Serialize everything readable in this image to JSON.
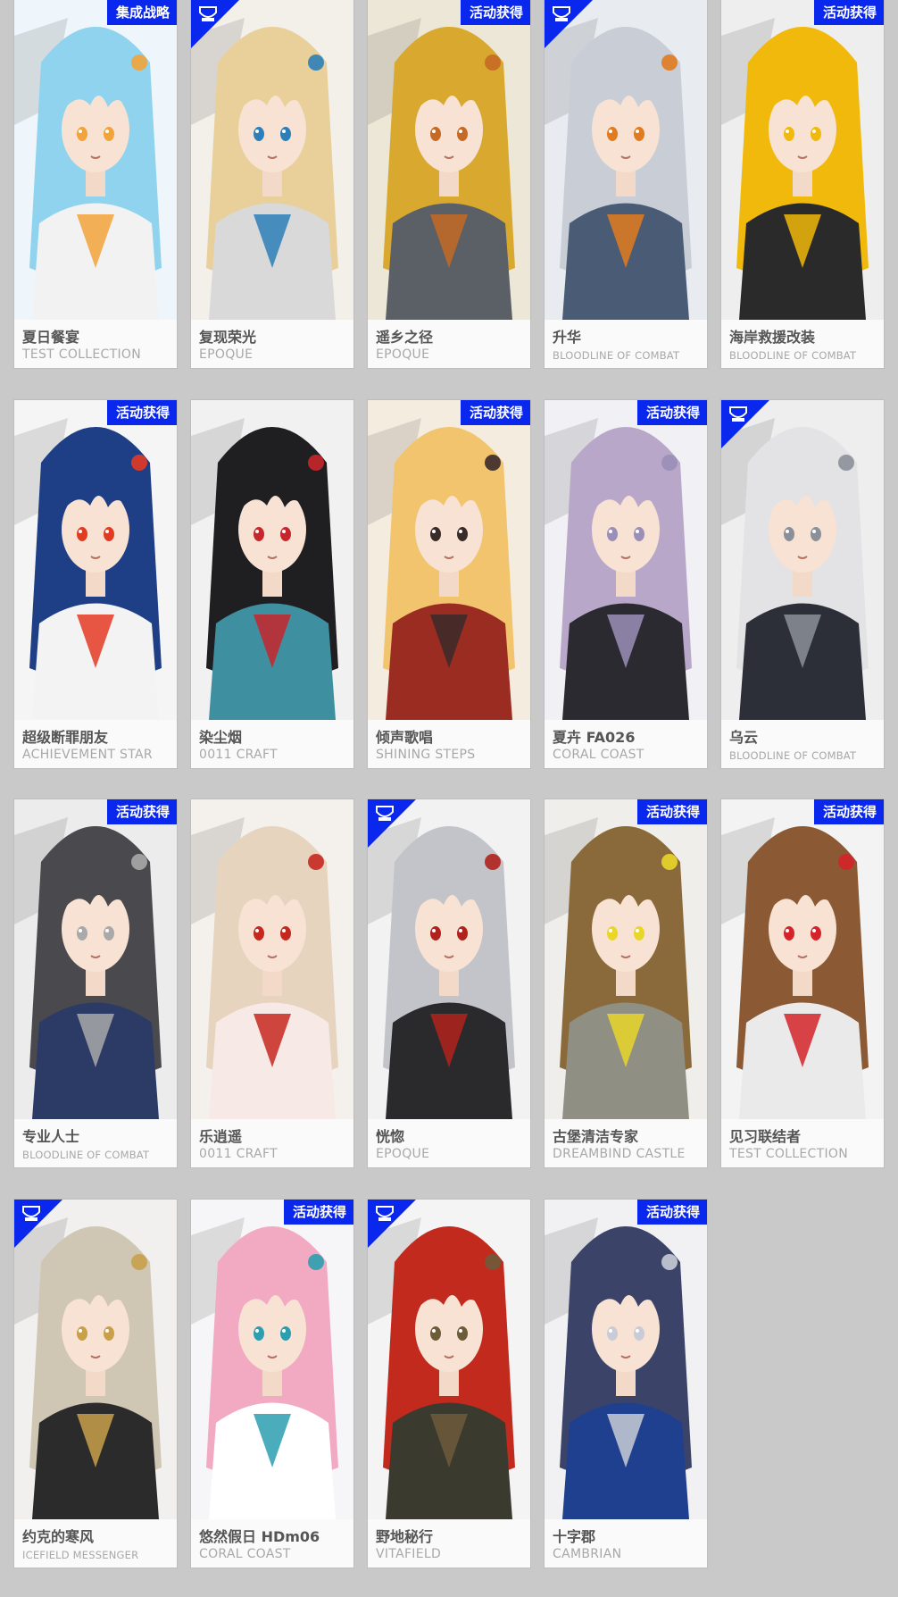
{
  "badge_text": "活动获得",
  "cards": [
    {
      "cn": "夏日餐宴",
      "en": "TEST COLLECTION",
      "badge": "集成战略",
      "hair": "#8fd3ee",
      "bg": "#eef6fb",
      "coat": "#f2f2f2",
      "accent": "#f2a33a"
    },
    {
      "cn": "复现荣光",
      "en": "EPOQUE",
      "badge": "corner",
      "hair": "#e9cf9a",
      "bg": "#f3f0ea",
      "coat": "#d9d9d9",
      "accent": "#2c7fb8"
    },
    {
      "cn": "遥乡之径",
      "en": "EPOQUE",
      "badge": "活动获得",
      "hair": "#d9a92f",
      "bg": "#ede7d7",
      "coat": "#5b5f66",
      "accent": "#c56a25"
    },
    {
      "cn": "升华",
      "en": "BLOODLINE OF COMBAT",
      "badge": "corner",
      "hair": "#c9ced6",
      "bg": "#e8ecf1",
      "coat": "#4a5b75",
      "accent": "#e07b1f"
    },
    {
      "cn": "海岸救援改装",
      "en": "BLOODLINE OF COMBAT",
      "badge": "活动获得",
      "hair": "#f0b90b",
      "bg": "#eeeeee",
      "coat": "#2a2a2a",
      "accent": "#f0b90b"
    },
    {
      "cn": "超级断罪朋友",
      "en": "ACHIEVEMENT STAR",
      "badge": "活动获得",
      "hair": "#1e3f86",
      "bg": "#f5f5f5",
      "coat": "#f3f3f3",
      "accent": "#e33a22"
    },
    {
      "cn": "染尘烟",
      "en": "0011 CRAFT",
      "badge": "",
      "hair": "#1f1f22",
      "bg": "#f1f1f1",
      "coat": "#3e8fa0",
      "accent": "#c7262b"
    },
    {
      "cn": "倾声歌唱",
      "en": "SHINING STEPS",
      "badge": "活动获得",
      "hair": "#f2c46e",
      "bg": "#f5ece0",
      "coat": "#9b2c22",
      "accent": "#3a2a2a"
    },
    {
      "cn": "夏卉 FA026",
      "en": "CORAL COAST",
      "badge": "活动获得",
      "hair": "#b8a7c9",
      "bg": "#f1f0f4",
      "coat": "#2a2a30",
      "accent": "#9a8fb8"
    },
    {
      "cn": "乌云",
      "en": "BLOODLINE OF COMBAT",
      "badge": "corner",
      "hair": "#e3e3e6",
      "bg": "#eeeeee",
      "coat": "#2d2f38",
      "accent": "#8b8f99"
    },
    {
      "cn": "专业人士",
      "en": "BLOODLINE OF COMBAT",
      "badge": "活动获得",
      "hair": "#4a4a4e",
      "bg": "#ececec",
      "coat": "#2c3a66",
      "accent": "#a9a9a9"
    },
    {
      "cn": "乐逍遥",
      "en": "0011 CRAFT",
      "badge": "",
      "hair": "#e6d4bf",
      "bg": "#f4f1ec",
      "coat": "#f7e9e6",
      "accent": "#c5281f"
    },
    {
      "cn": "恍惚",
      "en": "EPOQUE",
      "badge": "corner",
      "hair": "#c2c4c9",
      "bg": "#f2f2f2",
      "coat": "#2a2a2d",
      "accent": "#b0221c"
    },
    {
      "cn": "古堡清洁专家",
      "en": "DREAMBIND CASTLE",
      "badge": "活动获得",
      "hair": "#8a6a3a",
      "bg": "#efeeea",
      "coat": "#8f8f84",
      "accent": "#e8d629"
    },
    {
      "cn": "见习联结者",
      "en": "TEST COLLECTION",
      "badge": "活动获得",
      "hair": "#8b5a34",
      "bg": "#f3f3f3",
      "coat": "#eaeaea",
      "accent": "#d4242a"
    },
    {
      "cn": "约克的寒风",
      "en": "ICEFIELD MESSENGER",
      "badge": "corner",
      "hair": "#cfc6b4",
      "bg": "#f1f0ee",
      "coat": "#2b2b2b",
      "accent": "#c9a04a"
    },
    {
      "cn": "悠然假日 HDm06",
      "en": "CORAL COAST",
      "badge": "活动获得",
      "hair": "#f2a9c2",
      "bg": "#f6f6f8",
      "coat": "#ffffff",
      "accent": "#2b9fb0"
    },
    {
      "cn": "野地秘行",
      "en": "VITAFIELD",
      "badge": "corner",
      "hair": "#c32a1e",
      "bg": "#f4f4f4",
      "coat": "#3a3a2f",
      "accent": "#6e5b3a"
    },
    {
      "cn": "十字郡",
      "en": "CAMBRIAN",
      "badge": "活动获得",
      "hair": "#3b4468",
      "bg": "#f1f1f3",
      "coat": "#1f3f8f",
      "accent": "#c9ccd6"
    }
  ]
}
